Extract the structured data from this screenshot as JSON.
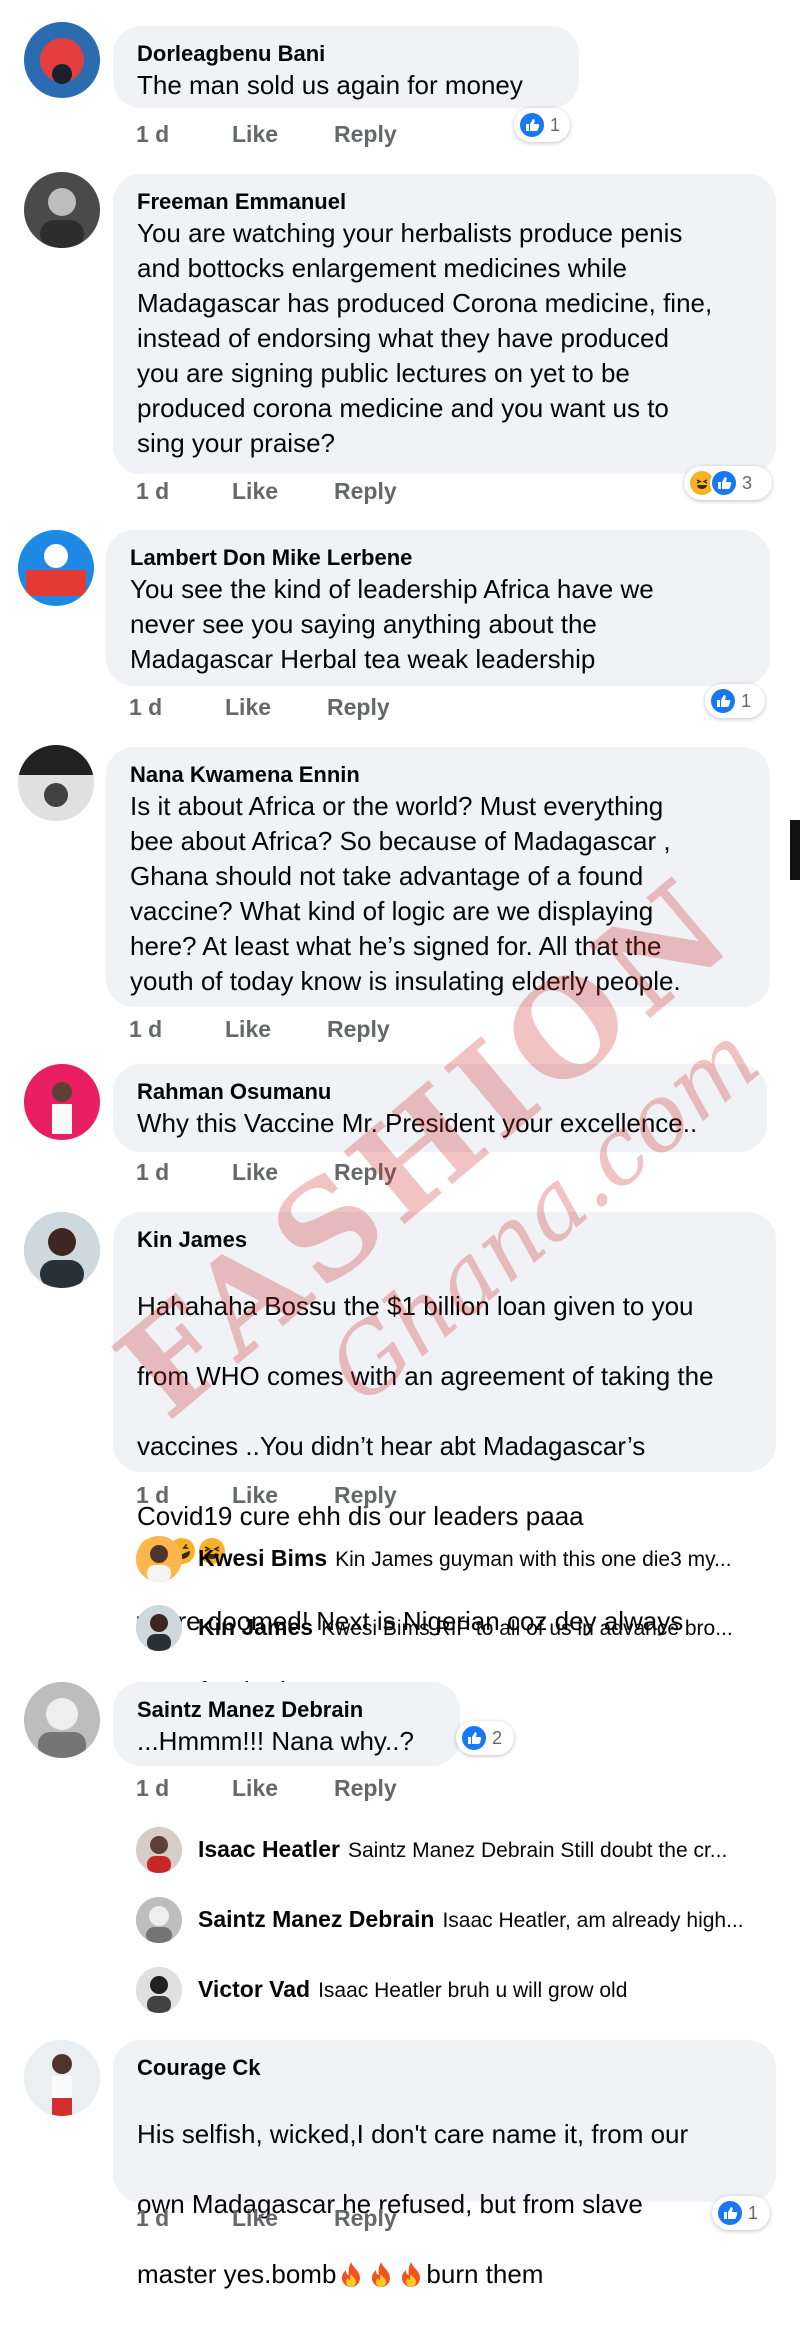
{
  "colors": {
    "bubble": "#f0f2f5",
    "meta_text": "#65676b",
    "like_blue": "#1877f2",
    "haha_yellow": "#f7b125",
    "watermark_red": "#ce2828"
  },
  "watermark": {
    "main": "FASHION",
    "sub": "Ghana.com"
  },
  "comments": [
    {
      "author": "Dorleagbenu Bani",
      "text": "The man sold us again for money",
      "time": "1 d",
      "like": "Like",
      "reply": "Reply",
      "reactions": {
        "icons": [
          "like-icon"
        ],
        "count": "1"
      }
    },
    {
      "author": "Freeman Emmanuel",
      "text": "You are watching your herbalists produce penis\nand bottocks enlargement medicines while\nMadagascar has produced Corona medicine, fine,\ninstead of endorsing what they have produced\nyou are signing public lectures on yet to be\nproduced corona medicine and you want us to\nsing your praise?",
      "time": "1 d",
      "like": "Like",
      "reply": "Reply",
      "reactions": {
        "icons": [
          "haha-icon",
          "like-icon"
        ],
        "count": "3"
      }
    },
    {
      "author": "Lambert Don Mike Lerbene",
      "text": "You see the kind of leadership Africa have we\nnever see you saying anything about the\nMadagascar Herbal tea weak leadership",
      "time": "1 d",
      "like": "Like",
      "reply": "Reply",
      "reactions": {
        "icons": [
          "like-icon"
        ],
        "count": "1"
      }
    },
    {
      "author": "Nana Kwamena Ennin",
      "text": "Is it about Africa or the world? Must everything\nbee about Africa? So because of Madagascar ,\nGhana should not take advantage of a found\nvaccine? What kind of logic are we displaying\nhere? At least what he’s signed for. All that the\nyouth  of today know is insulating elderly people.",
      "time": "1 d",
      "like": "Like",
      "reply": "Reply"
    },
    {
      "author": "Rahman Osumanu",
      "text": "Why this Vaccine Mr. President your  excellence..",
      "time": "1 d",
      "like": "Like",
      "reply": "Reply"
    },
    {
      "author": "Kin James",
      "text_lines": [
        "Hahahaha Bossu the $1 billion loan given to you",
        "from WHO comes with an agreement of taking the",
        "vaccines ..You didn’t hear abt Madagascar’s",
        "Covid19 cure ehh dis our leaders paaa",
        "we re doomed! Next is Nigerian coz dey always",
        "went for the loan.."
      ],
      "time": "1 d",
      "like": "Like",
      "reply": "Reply",
      "replies": [
        {
          "author": "Kwesi Bims",
          "snippet": "Kin James guyman with this one die3 my..."
        },
        {
          "author": "Kin James",
          "snippet": "Kwesi Bims RIP to all of us in advance bro..."
        }
      ]
    },
    {
      "author": "Saintz Manez Debrain",
      "text": "...Hmmm!!! Nana why..?",
      "time": "1 d",
      "like": "Like",
      "reply": "Reply",
      "reactions": {
        "icons": [
          "like-icon"
        ],
        "count": "2"
      },
      "replies": [
        {
          "author": "Isaac Heatler",
          "snippet": "Saintz Manez Debrain  Still doubt the cr..."
        },
        {
          "author": "Saintz Manez Debrain",
          "snippet": "Isaac Heatler, am already high..."
        },
        {
          "author": "Victor Vad",
          "snippet": "Isaac Heatler bruh u will grow old"
        }
      ]
    },
    {
      "author": "Courage Ck",
      "text_lines": [
        "His selfish, wicked,I don't care name it, from our",
        "own Madagascar he refused, but from slave",
        "master yes.bomb",
        "burn them"
      ],
      "time": "1 d",
      "like": "Like",
      "reply": "Reply",
      "reactions": {
        "icons": [
          "like-icon"
        ],
        "count": "1"
      }
    }
  ]
}
